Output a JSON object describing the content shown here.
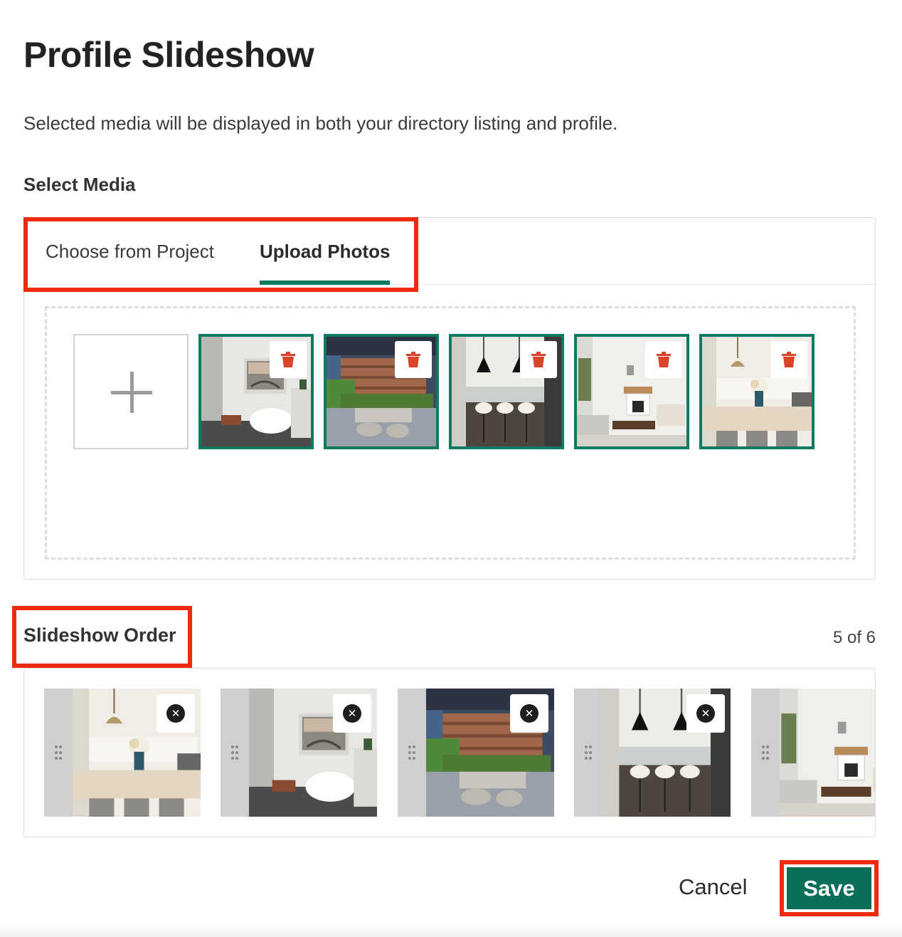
{
  "header": {
    "title": "Profile Slideshow",
    "description": "Selected media will be displayed in both your directory listing and profile."
  },
  "select_media": {
    "label": "Select Media",
    "tabs": [
      {
        "label": "Choose from Project",
        "active": false
      },
      {
        "label": "Upload Photos",
        "active": true
      }
    ],
    "add_icon": "plus-icon",
    "delete_icon": "trash-icon",
    "photos": [
      {
        "scene": "bathroom",
        "selected": true
      },
      {
        "scene": "patio",
        "selected": true
      },
      {
        "scene": "kitchen-pendants",
        "selected": true
      },
      {
        "scene": "living-room",
        "selected": true
      },
      {
        "scene": "kitchen-island",
        "selected": true
      }
    ]
  },
  "slideshow_order": {
    "label": "Slideshow Order",
    "count": "5 of 6",
    "remove_icon": "close-circle-icon",
    "handle_icon": "drag-handle-icon",
    "items": [
      {
        "scene": "kitchen-island"
      },
      {
        "scene": "bathroom"
      },
      {
        "scene": "patio"
      },
      {
        "scene": "kitchen-pendants"
      },
      {
        "scene": "living-room"
      }
    ]
  },
  "footer": {
    "cancel_label": "Cancel",
    "save_label": "Save"
  },
  "colors": {
    "accent_green": "#0b7a61",
    "save_green": "#0b6e58",
    "highlight_red": "#ee2a11",
    "trash_red": "#d9442b"
  }
}
